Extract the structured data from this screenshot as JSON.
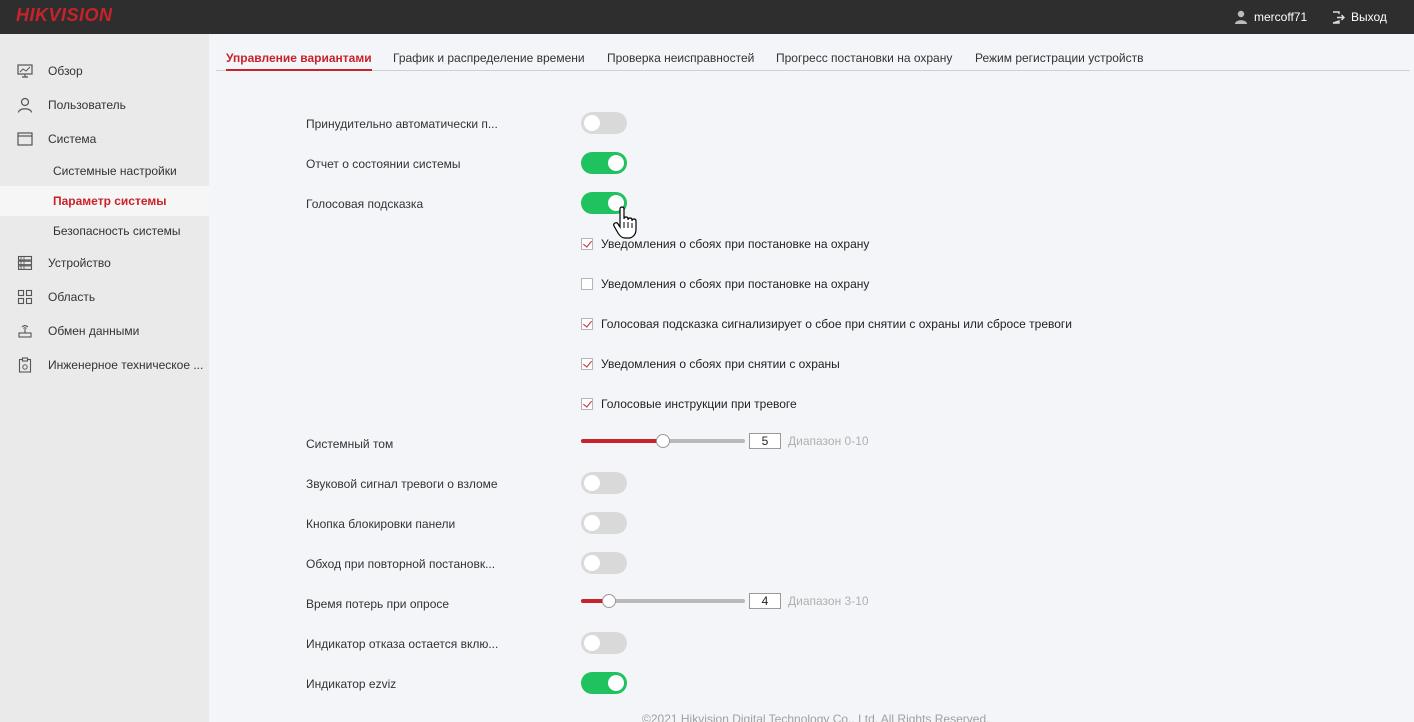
{
  "header": {
    "logo": "HIKVISION",
    "username": "mercoff71",
    "logout_label": "Выход"
  },
  "sidebar": {
    "items": [
      {
        "label": "Обзор",
        "icon": "monitor-icon"
      },
      {
        "label": "Пользователь",
        "icon": "user-icon"
      },
      {
        "label": "Система",
        "icon": "window-icon"
      },
      {
        "label": "Системные настройки"
      },
      {
        "label": "Параметр системы",
        "active": true
      },
      {
        "label": "Безопасность системы"
      },
      {
        "label": "Устройство",
        "icon": "server-icon"
      },
      {
        "label": "Область",
        "icon": "grid-icon"
      },
      {
        "label": "Обмен данными",
        "icon": "router-icon"
      },
      {
        "label": "Инженерное техническое ..."
      }
    ]
  },
  "tabs": [
    {
      "label": "Управление вариантами",
      "active": true
    },
    {
      "label": "График и распределение времени"
    },
    {
      "label": "Проверка неисправностей"
    },
    {
      "label": "Прогресс постановки на охрану"
    },
    {
      "label": "Режим регистрации устройств"
    }
  ],
  "settings": {
    "force_auto": {
      "label": "Принудительно автоматически п...",
      "on": false
    },
    "status_report": {
      "label": "Отчет о состоянии системы",
      "on": true
    },
    "voice_prompt": {
      "label": "Голосовая подсказка",
      "on": true
    },
    "checks": [
      {
        "label": "Уведомления о сбоях при постановке на охрану",
        "checked": true
      },
      {
        "label": "Уведомления о сбоях при постановке на охрану",
        "checked": false
      },
      {
        "label": "Голосовая подсказка сигнализирует о сбое при снятии с охраны или сбросе тревоги",
        "checked": true
      },
      {
        "label": "Уведомления о сбоях при снятии с охраны",
        "checked": true
      },
      {
        "label": "Голосовые инструкции при тревоге",
        "checked": true
      }
    ],
    "volume": {
      "label": "Системный том",
      "value": "5",
      "min": 0,
      "max": 10,
      "hint": "Диапазон 0-10"
    },
    "tamper_sound": {
      "label": "Звуковой сигнал тревоги о взломе",
      "on": false
    },
    "panel_lock": {
      "label": "Кнопка блокировки панели",
      "on": false
    },
    "bypass_rearm": {
      "label": "Обход при повторной постановк...",
      "on": false
    },
    "poll_loss": {
      "label": "Время потерь при опросе",
      "value": "4",
      "min": 3,
      "max": 10,
      "hint": "Диапазон 3-10"
    },
    "fault_indicator": {
      "label": "Индикатор отказа остается вклю...",
      "on": false
    },
    "ezviz_indicator": {
      "label": "Индикатор ezviz",
      "on": true
    }
  },
  "footer": {
    "copyright": "©2021 Hikvision Digital Technology Co., Ltd. All Rights Reserved."
  },
  "colors": {
    "accent": "#c8222a",
    "toggle_on": "#1fc25f",
    "toggle_off": "#d9d9d9",
    "topbar": "#2e2e2e"
  }
}
